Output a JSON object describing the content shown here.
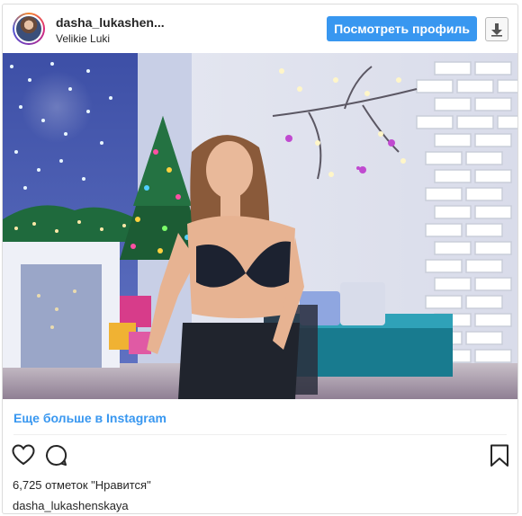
{
  "header": {
    "username": "dasha_lukashen...",
    "location": "Velikie Luki",
    "profile_button": "Посмотреть профиль",
    "download_icon": "download-arrow-icon"
  },
  "photo": {
    "description_icon": "photo",
    "accent_colors": [
      "#3a4aa8",
      "#9fb2e0",
      "#e8ecf6",
      "#1f7a8a",
      "#d66aa0"
    ]
  },
  "more_link": "Еще больше в Instagram",
  "actions": {
    "like_icon": "heart-icon",
    "comment_icon": "comment-icon",
    "save_icon": "bookmark-icon"
  },
  "likes_text": "6,725 отметок \"Нравится\"",
  "caption_username": "dasha_lukashenskaya",
  "colors": {
    "accent": "#3897f0",
    "text": "#262626",
    "border": "#dbdbdb"
  }
}
